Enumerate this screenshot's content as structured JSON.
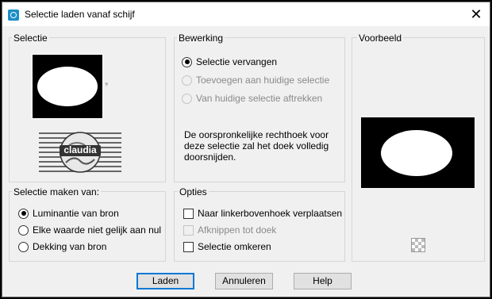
{
  "window": {
    "title": "Selectie laden vanaf schijf",
    "close_glyph": "✕"
  },
  "selectie": {
    "label": "Selectie",
    "thumb_arrow": "▾",
    "logo_text": "claudia"
  },
  "bewerking": {
    "label": "Bewerking",
    "options": [
      {
        "label": "Selectie vervangen",
        "checked": true,
        "enabled": true
      },
      {
        "label": "Toevoegen aan huidige selectie",
        "checked": false,
        "enabled": false
      },
      {
        "label": "Van huidige selectie aftrekken",
        "checked": false,
        "enabled": false
      }
    ],
    "description": "De oorspronkelijke rechthoek voor deze selectie zal het doek volledig doorsnijden."
  },
  "voorbeeld": {
    "label": "Voorbeeld"
  },
  "maken_van": {
    "label": "Selectie maken van:",
    "options": [
      {
        "label": "Luminantie van bron",
        "checked": true
      },
      {
        "label": "Elke waarde niet gelijk aan nul",
        "checked": false
      },
      {
        "label": "Dekking van bron",
        "checked": false
      }
    ]
  },
  "opties": {
    "label": "Opties",
    "options": [
      {
        "label": "Naar linkerbovenhoek verplaatsen",
        "checked": false,
        "enabled": true
      },
      {
        "label": "Afknippen tot doek",
        "checked": false,
        "enabled": false
      },
      {
        "label": "Selectie omkeren",
        "checked": false,
        "enabled": true
      }
    ]
  },
  "buttons": {
    "load": "Laden",
    "cancel": "Annuleren",
    "help": "Help"
  },
  "colors": {
    "accent": "#0078d7",
    "icon": "#1b8fc7"
  }
}
